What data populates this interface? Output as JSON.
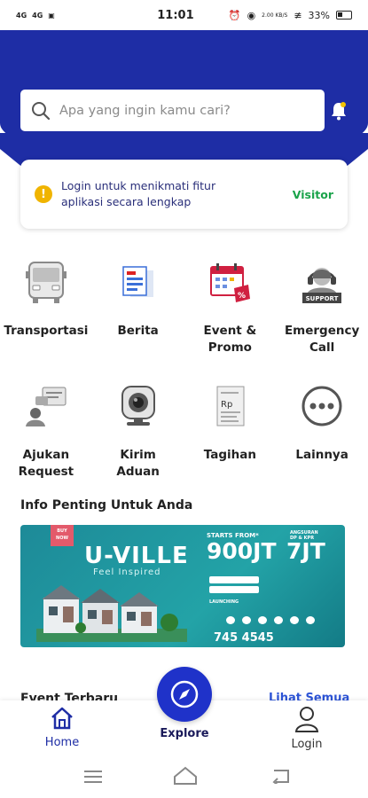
{
  "status_bar": {
    "signal1": "4G",
    "signal2": "4G",
    "time": "11:01",
    "data_speed": "2.00 KB/S",
    "battery": "33%"
  },
  "search": {
    "placeholder": "Apa yang ingin kamu cari?"
  },
  "login_banner": {
    "message": "Login untuk menikmati fitur aplikasi secara lengkap",
    "visitor_label": "Visitor"
  },
  "menu": {
    "row1": [
      {
        "label": "Transportasi",
        "icon": "bus-icon"
      },
      {
        "label": "Berita",
        "icon": "news-icon"
      },
      {
        "label": "Event &\nPromo",
        "icon": "calendar-promo-icon"
      },
      {
        "label": "Emergency\nCall",
        "icon": "support-agent-icon"
      }
    ],
    "row2": [
      {
        "label": "Ajukan\nRequest",
        "icon": "request-chat-icon"
      },
      {
        "label": "Kirim\nAduan",
        "icon": "webcam-icon"
      },
      {
        "label": "Tagihan",
        "icon": "bill-icon"
      },
      {
        "label": "Lainnya",
        "icon": "more-dots-icon"
      }
    ]
  },
  "info_section": {
    "title": "Info Penting Untuk Anda"
  },
  "banner": {
    "ribbon": "BUY NOW",
    "brand": "U-VILLE",
    "tagline": "Feel Inspired",
    "starts_from_label": "STARTS FROM*",
    "price": "900JT",
    "installment_label": "ANGSURAN DP & KPR",
    "installment": "7JT",
    "launching": "LAUNCHING",
    "phone": "745 4545"
  },
  "event_section": {
    "title": "Event Terbaru",
    "see_all": "Lihat Semua"
  },
  "bottom_nav": {
    "home": "Home",
    "explore": "Explore",
    "login": "Login"
  },
  "colors": {
    "primary": "#1e2da5",
    "accent_green": "#1aa34a",
    "warning": "#f0b400",
    "link": "#2d54d6"
  }
}
